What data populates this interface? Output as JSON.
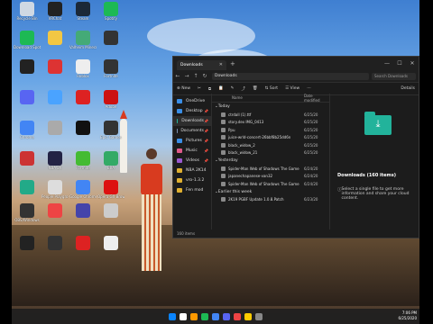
{
  "desktop_icons": [
    {
      "label": "Recycle Bin",
      "color": "#cfd8e3"
    },
    {
      "label": "VRChat",
      "color": "#222"
    },
    {
      "label": "Steam",
      "color": "#1b2838"
    },
    {
      "label": "Spotify",
      "color": "#1db954"
    },
    {
      "label": "Download Spotify",
      "color": "#1db954"
    },
    {
      "label": "",
      "color": "#f2c744"
    },
    {
      "label": "Valheim Minecraft",
      "color": "#4a7"
    },
    {
      "label": "",
      "color": "#333"
    },
    {
      "label": "",
      "color": "#222"
    },
    {
      "label": "",
      "color": "#d33"
    },
    {
      "label": "Roblox",
      "color": "#eee"
    },
    {
      "label": "Fortnite",
      "color": "#333"
    },
    {
      "label": "",
      "color": "#5865f2"
    },
    {
      "label": "",
      "color": "#4aa3ff"
    },
    {
      "label": "",
      "color": "#d22"
    },
    {
      "label": "Adobe",
      "color": "#c11"
    },
    {
      "label": "Chrome",
      "color": "#4285f4"
    },
    {
      "label": "",
      "color": "#aaa"
    },
    {
      "label": "",
      "color": "#111"
    },
    {
      "label": "Epic Games",
      "color": "#333"
    },
    {
      "label": "",
      "color": "#c33"
    },
    {
      "label": "NBA 2K",
      "color": "#224"
    },
    {
      "label": "Fortnite",
      "color": "#4b3"
    },
    {
      "label": "ERA",
      "color": "#3a6"
    },
    {
      "label": "",
      "color": "#2a8"
    },
    {
      "label": "People Playground",
      "color": "#ddd"
    },
    {
      "label": "Google Chrome",
      "color": "#4285f4"
    },
    {
      "label": "Opera GX Browser",
      "color": "#d11"
    },
    {
      "label": "OBS/Windows",
      "color": "#333"
    },
    {
      "label": "",
      "color": "#e44"
    },
    {
      "label": "",
      "color": "#44a"
    },
    {
      "label": "",
      "color": "#ccc"
    },
    {
      "label": "",
      "color": "#222"
    },
    {
      "label": "",
      "color": "#333"
    },
    {
      "label": "",
      "color": "#d22"
    },
    {
      "label": "",
      "color": "#eee"
    }
  ],
  "explorer": {
    "tab_title": "Downloads",
    "address": "Downloads",
    "search_placeholder": "Search Downloads",
    "toolbar": {
      "new": "New",
      "sort": "Sort",
      "view": "View",
      "details": "Details"
    },
    "nav_items": [
      {
        "label": "OneDrive",
        "color": "#3a8ee6"
      },
      {
        "label": "Desktop",
        "color": "#3a8ee6"
      },
      {
        "label": "Downloads",
        "color": "#22b39b"
      },
      {
        "label": "Documents",
        "color": "#7a8fb0"
      },
      {
        "label": "Pictures",
        "color": "#3a8ee6"
      },
      {
        "label": "Music",
        "color": "#e05a8a"
      },
      {
        "label": "Videos",
        "color": "#9b59d0"
      },
      {
        "label": "NBA 2K14",
        "color": "#e0b030"
      },
      {
        "label": "vro-1.3.2",
        "color": "#e0b030"
      },
      {
        "label": "Fen mod",
        "color": "#e0b030"
      }
    ],
    "columns": {
      "name": "Name",
      "date": "Date modified"
    },
    "groups": [
      {
        "label": "Today",
        "files": [
          {
            "name": "ctrdall (1).ttf",
            "date": "6/25/20"
          },
          {
            "name": "story.dex IMG_0413",
            "date": "6/25/20"
          },
          {
            "name": "Ppu",
            "date": "6/25/20"
          },
          {
            "name": "juice-wrld-concert-26bbf8b25dd6n",
            "date": "6/25/20"
          },
          {
            "name": "black_widow_2",
            "date": "6/25/20"
          },
          {
            "name": "black_widow_21",
            "date": "6/25/20"
          }
        ]
      },
      {
        "label": "Yesterday",
        "files": [
          {
            "name": "Spider-Man Web of Shadows The Game",
            "date": "6/24/20"
          },
          {
            "name": "japanechapanese-van32",
            "date": "6/24/20"
          },
          {
            "name": "Spider-Man Web of Shadows The Game",
            "date": "6/24/20"
          }
        ]
      },
      {
        "label": "Earlier this week",
        "files": [
          {
            "name": "2K19 PGBF Update 1.0.8.Patch",
            "date": "6/23/20"
          }
        ]
      }
    ],
    "details_title": "Downloads (160 items)",
    "details_info": "Select a single file to get more information and share your cloud content.",
    "status": "160 items"
  },
  "taskbar": {
    "icons": [
      "#0a84ff",
      "#ffffff",
      "#ff9900",
      "#1db954",
      "#4285f4",
      "#5865f2",
      "#e44",
      "#ffcc00",
      "#888"
    ],
    "time": "7:06 PM",
    "date": "6/25/2020"
  }
}
